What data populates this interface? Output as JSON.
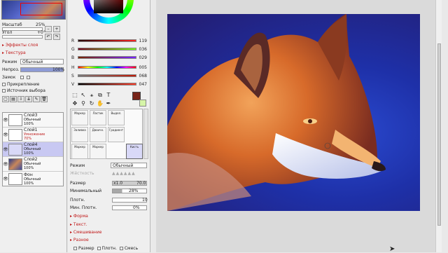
{
  "nav": {
    "scale_label": "Масштаб",
    "scale_value": "25%",
    "angle_label": "Угол",
    "angle_value": "+0°"
  },
  "layer_panel": {
    "layer_effects": "Эффекты слоя",
    "texture": "Текстура",
    "mode_label": "Режим",
    "mode_value": "Обычный",
    "opacity_label": "Непроз.",
    "opacity_value": "100%",
    "lock_label": "Замок",
    "clip_label": "Прикрепление",
    "source_label": "Источник выбора",
    "layers": [
      {
        "name": "Слой3",
        "mode": "Обычный",
        "opacity": "100%",
        "selected": false
      },
      {
        "name": "Слой1",
        "mode": "Умножение",
        "opacity": "70%",
        "selected": false
      },
      {
        "name": "Слой4",
        "mode": "Обычный",
        "opacity": "100%",
        "selected": true
      },
      {
        "name": "Слой2",
        "mode": "Обычный",
        "opacity": "100%",
        "selected": false
      },
      {
        "name": "Фон",
        "mode": "Обычный",
        "opacity": "100%",
        "selected": false
      }
    ]
  },
  "color": {
    "r_label": "R",
    "r_value": "119",
    "g_label": "G",
    "g_value": "036",
    "b_label": "B",
    "b_value": "029",
    "h_label": "H",
    "h_value": "005",
    "s_label": "S",
    "s_value": "068",
    "v_label": "V",
    "v_value": "047",
    "current_hex": "#772419",
    "secondary_hex": "#d6f5a8"
  },
  "tools": [
    {
      "label": "Маркер",
      "icon": "marker-icon"
    },
    {
      "label": "Ластик",
      "icon": "eraser-icon"
    },
    {
      "label": "Выдел.",
      "icon": "select-icon"
    },
    {
      "label": "Заливка",
      "icon": "bucket-icon"
    },
    {
      "label": "Двоичн.",
      "icon": "binary-pen-icon"
    },
    {
      "label": "Градиент",
      "icon": "gradient-icon"
    },
    {
      "label": "Маркер",
      "icon": "marker-icon"
    },
    {
      "label": "Маркер",
      "icon": "marker-icon"
    },
    {
      "label": "Кисть",
      "icon": "brush-icon"
    }
  ],
  "brush": {
    "mode_label": "Режим",
    "mode_value": "Обычный",
    "hardness_label": "Жёсткость",
    "size_label": "Размер",
    "size_mult": "x1.0",
    "size_value": "70.0",
    "min_size_label": "Минимальный",
    "min_size_value": "28%",
    "density_label": "Плотн.",
    "density_value": "10",
    "min_density_label": "Мин. Плотн.",
    "min_density_value": "0%",
    "form": "Форма",
    "texture": "Текст.",
    "blending": "Смешивание",
    "more": "Разное",
    "chk_size": "Размер",
    "chk_density": "Плотн.",
    "chk_blend": "Смесь"
  }
}
